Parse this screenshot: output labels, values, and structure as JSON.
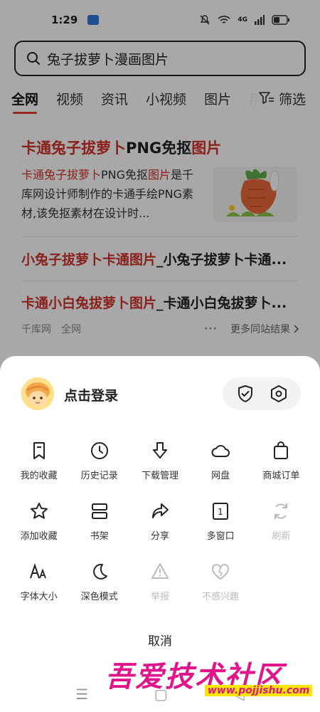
{
  "status_bar": {
    "time": "1:29",
    "signal_text": "4G"
  },
  "search": {
    "query": "兔子拔萝卜漫画图片"
  },
  "tabs": [
    "全网",
    "视频",
    "资讯",
    "小视频",
    "图片",
    "用"
  ],
  "filter_label": "筛选",
  "results": {
    "r1": {
      "title_red1": "卡通兔子拔萝卜",
      "title_plain": "PNG免抠",
      "title_red2": "图片",
      "desc_red1": "卡通兔子拔萝卜",
      "desc_plain1": "PNG免抠",
      "desc_red2": "图片",
      "desc_rest": "是千库网设计师制作的卡通手绘PNG素材,该免抠素材在设计时..."
    },
    "r2": {
      "red": "小兔子拔萝卜卡通图片",
      "plain": "_小兔子拔萝卜卡通..."
    },
    "r3": {
      "red": "卡通小白兔拔萝卜图片",
      "plain": "_卡通小白兔拔萝卜..."
    },
    "footer": {
      "source": "千库网",
      "scope": "全网",
      "more": "更多同站结果"
    }
  },
  "sheet": {
    "login": "点击登录",
    "items": [
      {
        "label": "我的收藏",
        "icon": "bookmark-icon",
        "enabled": true
      },
      {
        "label": "历史记录",
        "icon": "clock-icon",
        "enabled": true
      },
      {
        "label": "下载管理",
        "icon": "download-icon",
        "enabled": true
      },
      {
        "label": "网盘",
        "icon": "cloud-icon",
        "enabled": true
      },
      {
        "label": "商城订单",
        "icon": "shopping-bag-icon",
        "enabled": true
      },
      {
        "label": "添加收藏",
        "icon": "star-icon",
        "enabled": true
      },
      {
        "label": "书架",
        "icon": "bookshelf-icon",
        "enabled": true
      },
      {
        "label": "分享",
        "icon": "share-icon",
        "enabled": true
      },
      {
        "label": "多窗口",
        "icon": "window-count-icon",
        "enabled": true,
        "badge": "1"
      },
      {
        "label": "刷新",
        "icon": "refresh-icon",
        "enabled": false
      },
      {
        "label": "字体大小",
        "icon": "font-size-icon",
        "enabled": true
      },
      {
        "label": "深色模式",
        "icon": "moon-icon",
        "enabled": true
      },
      {
        "label": "举报",
        "icon": "warning-icon",
        "enabled": false
      },
      {
        "label": "不感兴趣",
        "icon": "broken-heart-icon",
        "enabled": false
      }
    ],
    "cancel": "取消"
  },
  "watermark": {
    "text": "吾爱技术社区",
    "url": "www.pojjishu.com"
  },
  "colors": {
    "accent_red": "#d3322b",
    "tab_underline": "#e24430",
    "watermark": "#e0158a"
  }
}
